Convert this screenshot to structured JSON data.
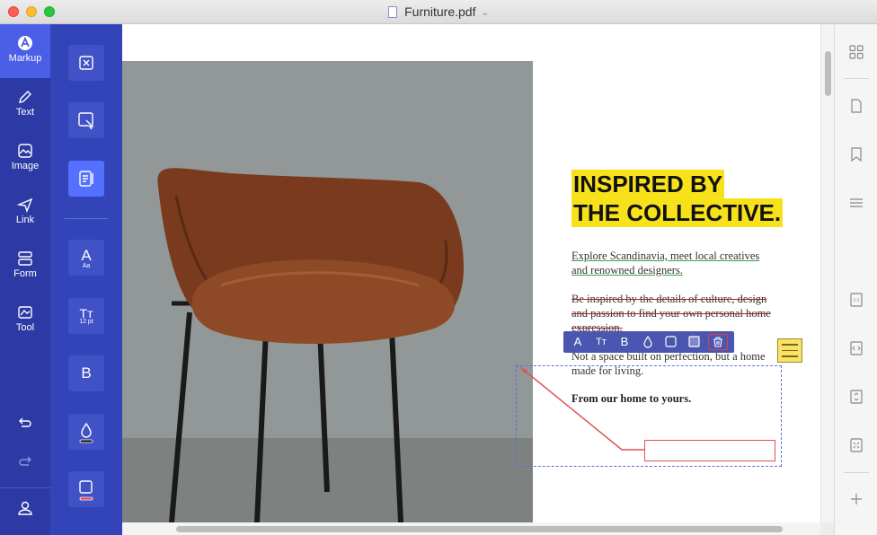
{
  "window": {
    "title": "Furniture.pdf"
  },
  "rail": {
    "items": [
      {
        "label": "Markup",
        "icon": "markup-icon"
      },
      {
        "label": "Text",
        "icon": "pencil-icon"
      },
      {
        "label": "Image",
        "icon": "image-icon"
      },
      {
        "label": "Link",
        "icon": "link-icon"
      },
      {
        "label": "Form",
        "icon": "form-icon"
      },
      {
        "label": "Tool",
        "icon": "tool-icon"
      }
    ],
    "undo_icon": "undo-icon",
    "redo_icon": "redo-icon",
    "account_icon": "user-icon"
  },
  "panel": {
    "tools": [
      {
        "icon": "close-box-icon"
      },
      {
        "icon": "select-box-icon"
      },
      {
        "icon": "textbox-comment-icon"
      },
      {
        "icon": "font-icon",
        "glyph": "A",
        "sub": "Aa"
      },
      {
        "icon": "font-size-icon",
        "glyph": "Tт",
        "sub": "12 pt"
      },
      {
        "icon": "bold-icon",
        "glyph": "B"
      },
      {
        "icon": "fill-color-icon"
      },
      {
        "icon": "border-color-icon"
      }
    ]
  },
  "document": {
    "heading_line1": "INSPIRED BY",
    "heading_line2": "THE COLLECTIVE.",
    "para1": "Explore Scandinavia, meet local creatives and renowned designers.",
    "para2": "Be inspired by the details of culture, design and passion to find your own personal home expression.",
    "para3": "Not a space built on perfection, but a home made for living.",
    "para4": "From our home to yours.",
    "highlight_color": "#f7e11a"
  },
  "context_toolbar": {
    "buttons": [
      "font-icon",
      "font-size-icon",
      "bold-icon",
      "fill-color-icon",
      "border-color-icon",
      "note-icon",
      "delete-icon"
    ]
  },
  "right_rail": {
    "icons": [
      "thumbnails-icon",
      "page-icon",
      "bookmark-icon",
      "outline-icon",
      "actual-size-icon",
      "fit-width-icon",
      "fit-page-icon",
      "fullscreen-icon",
      "add-icon"
    ]
  }
}
